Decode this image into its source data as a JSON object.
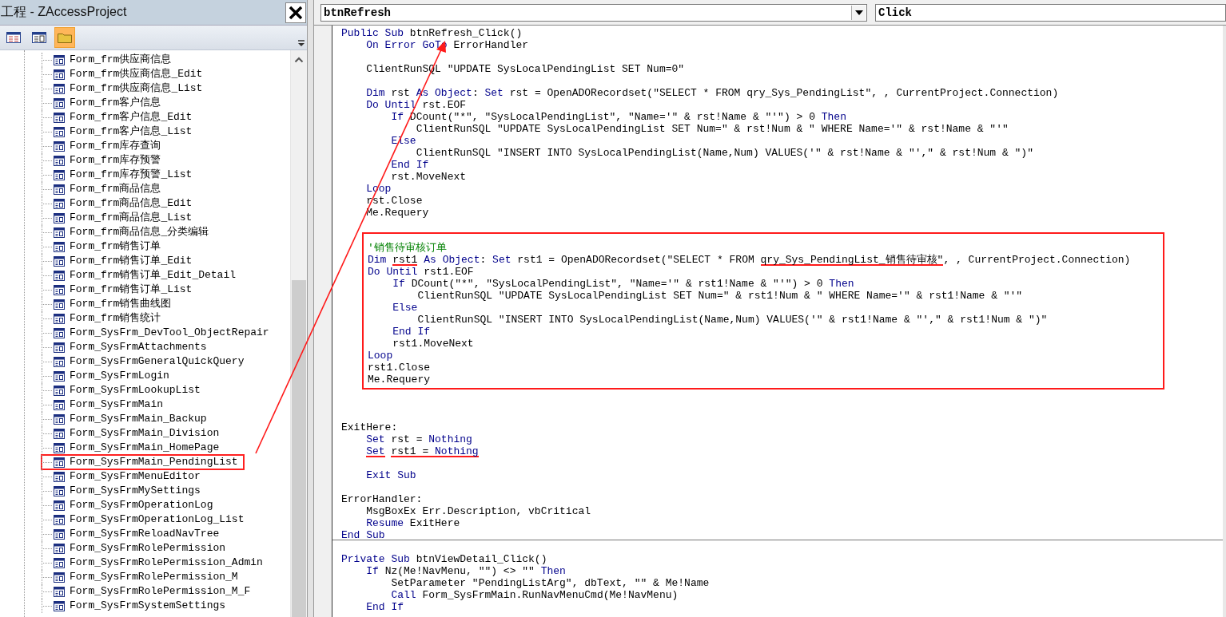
{
  "project_panel": {
    "title": "工程 - ZAccessProject",
    "toolbar": [
      {
        "kind": "view-code",
        "selected": false
      },
      {
        "kind": "view-object",
        "selected": false
      },
      {
        "kind": "toggle-folders",
        "selected": true
      }
    ],
    "tree_items": [
      {
        "label": "Form_frm供应商信息",
        "highlighted": false
      },
      {
        "label": "Form_frm供应商信息_Edit",
        "highlighted": false
      },
      {
        "label": "Form_frm供应商信息_List",
        "highlighted": false
      },
      {
        "label": "Form_frm客户信息",
        "highlighted": false
      },
      {
        "label": "Form_frm客户信息_Edit",
        "highlighted": false
      },
      {
        "label": "Form_frm客户信息_List",
        "highlighted": false
      },
      {
        "label": "Form_frm库存查询",
        "highlighted": false
      },
      {
        "label": "Form_frm库存预警",
        "highlighted": false
      },
      {
        "label": "Form_frm库存预警_List",
        "highlighted": false
      },
      {
        "label": "Form_frm商品信息",
        "highlighted": false
      },
      {
        "label": "Form_frm商品信息_Edit",
        "highlighted": false
      },
      {
        "label": "Form_frm商品信息_List",
        "highlighted": false
      },
      {
        "label": "Form_frm商品信息_分类编辑",
        "highlighted": false
      },
      {
        "label": "Form_frm销售订单",
        "highlighted": false
      },
      {
        "label": "Form_frm销售订单_Edit",
        "highlighted": false
      },
      {
        "label": "Form_frm销售订单_Edit_Detail",
        "highlighted": false
      },
      {
        "label": "Form_frm销售订单_List",
        "highlighted": false
      },
      {
        "label": "Form_frm销售曲线图",
        "highlighted": false
      },
      {
        "label": "Form_frm销售统计",
        "highlighted": false
      },
      {
        "label": "Form_SysFrm_DevTool_ObjectRepair",
        "highlighted": false
      },
      {
        "label": "Form_SysFrmAttachments",
        "highlighted": false
      },
      {
        "label": "Form_SysFrmGeneralQuickQuery",
        "highlighted": false
      },
      {
        "label": "Form_SysFrmLogin",
        "highlighted": false
      },
      {
        "label": "Form_SysFrmLookupList",
        "highlighted": false
      },
      {
        "label": "Form_SysFrmMain",
        "highlighted": false
      },
      {
        "label": "Form_SysFrmMain_Backup",
        "highlighted": false
      },
      {
        "label": "Form_SysFrmMain_Division",
        "highlighted": false
      },
      {
        "label": "Form_SysFrmMain_HomePage",
        "highlighted": false
      },
      {
        "label": "Form_SysFrmMain_PendingList",
        "highlighted": true
      },
      {
        "label": "Form_SysFrmMenuEditor",
        "highlighted": false
      },
      {
        "label": "Form_SysFrmMySettings",
        "highlighted": false
      },
      {
        "label": "Form_SysFrmOperationLog",
        "highlighted": false
      },
      {
        "label": "Form_SysFrmOperationLog_List",
        "highlighted": false
      },
      {
        "label": "Form_SysFrmReloadNavTree",
        "highlighted": false
      },
      {
        "label": "Form_SysFrmRolePermission",
        "highlighted": false
      },
      {
        "label": "Form_SysFrmRolePermission_Admin",
        "highlighted": false
      },
      {
        "label": "Form_SysFrmRolePermission_M",
        "highlighted": false
      },
      {
        "label": "Form_SysFrmRolePermission_M_F",
        "highlighted": false
      },
      {
        "label": "Form_SysFrmSystemSettings",
        "highlighted": false
      }
    ]
  },
  "editor": {
    "object_combo": "btnRefresh",
    "procedure_combo": "Click",
    "procedures": [
      {
        "blocks": [
          {
            "boxed": false,
            "lines": [
              {
                "kind": "code",
                "segments": [
                  {
                    "text": "Public Sub",
                    "kind": "keyword",
                    "underlined": false
                  },
                  {
                    "text": " btnRefresh_Click()",
                    "kind": "code",
                    "underlined": false
                  }
                ]
              },
              {
                "kind": "code",
                "segments": [
                  {
                    "text": "    On Error GoTo",
                    "kind": "keyword",
                    "underlined": false
                  },
                  {
                    "text": " ErrorHandler",
                    "kind": "code",
                    "underlined": false
                  }
                ]
              },
              {
                "kind": "blank"
              },
              {
                "kind": "code",
                "segments": [
                  {
                    "text": "    ClientRunSQL \"UPDATE SysLocalPendingList SET Num=0\"",
                    "kind": "code",
                    "underlined": false
                  }
                ]
              },
              {
                "kind": "blank"
              },
              {
                "kind": "code",
                "segments": [
                  {
                    "text": "    Dim",
                    "kind": "keyword",
                    "underlined": false
                  },
                  {
                    "text": " rst ",
                    "kind": "code",
                    "underlined": false
                  },
                  {
                    "text": "As Object",
                    "kind": "keyword",
                    "underlined": false
                  },
                  {
                    "text": ": ",
                    "kind": "code",
                    "underlined": false
                  },
                  {
                    "text": "Set",
                    "kind": "keyword",
                    "underlined": false
                  },
                  {
                    "text": " rst = OpenADORecordset(\"SELECT * FROM qry_Sys_PendingList\", , CurrentProject.Connection)",
                    "kind": "code",
                    "underlined": false
                  }
                ]
              },
              {
                "kind": "code",
                "segments": [
                  {
                    "text": "    Do Until",
                    "kind": "keyword",
                    "underlined": false
                  },
                  {
                    "text": " rst.EOF",
                    "kind": "code",
                    "underlined": false
                  }
                ]
              },
              {
                "kind": "code",
                "segments": [
                  {
                    "text": "        If",
                    "kind": "keyword",
                    "underlined": false
                  },
                  {
                    "text": " DCount(\"*\", \"SysLocalPendingList\", \"Name='\" & rst!Name & \"'\") > 0 ",
                    "kind": "code",
                    "underlined": false
                  },
                  {
                    "text": "Then",
                    "kind": "keyword",
                    "underlined": false
                  }
                ]
              },
              {
                "kind": "code",
                "segments": [
                  {
                    "text": "            ClientRunSQL \"UPDATE SysLocalPendingList SET Num=\" & rst!Num & \" WHERE Name='\" & rst!Name & \"'\"",
                    "kind": "code",
                    "underlined": false
                  }
                ]
              },
              {
                "kind": "code",
                "segments": [
                  {
                    "text": "        Else",
                    "kind": "keyword",
                    "underlined": false
                  }
                ]
              },
              {
                "kind": "code",
                "segments": [
                  {
                    "text": "            ClientRunSQL \"INSERT INTO SysLocalPendingList(Name,Num) VALUES('\" & rst!Name & \"',\" & rst!Num & \")\"",
                    "kind": "code",
                    "underlined": false
                  }
                ]
              },
              {
                "kind": "code",
                "segments": [
                  {
                    "text": "        End If",
                    "kind": "keyword",
                    "underlined": false
                  }
                ]
              },
              {
                "kind": "code",
                "segments": [
                  {
                    "text": "        rst.MoveNext",
                    "kind": "code",
                    "underlined": false
                  }
                ]
              },
              {
                "kind": "code",
                "segments": [
                  {
                    "text": "    Loop",
                    "kind": "keyword",
                    "underlined": false
                  }
                ]
              },
              {
                "kind": "code",
                "segments": [
                  {
                    "text": "    rst.Close",
                    "kind": "code",
                    "underlined": false
                  }
                ]
              },
              {
                "kind": "code",
                "segments": [
                  {
                    "text": "    Me.Requery",
                    "kind": "code",
                    "underlined": false
                  }
                ]
              },
              {
                "kind": "blank"
              }
            ]
          },
          {
            "boxed": true,
            "lines": [
              {
                "kind": "code",
                "segments": [
                  {
                    "text": "'销售待审核订单",
                    "kind": "comment",
                    "underlined": false
                  }
                ]
              },
              {
                "kind": "code",
                "segments": [
                  {
                    "text": "Dim ",
                    "kind": "keyword",
                    "underlined": false
                  },
                  {
                    "text": "rst1",
                    "kind": "code",
                    "underlined": true
                  },
                  {
                    "text": " As Object",
                    "kind": "keyword",
                    "underlined": false
                  },
                  {
                    "text": ": ",
                    "kind": "code",
                    "underlined": false
                  },
                  {
                    "text": "Set",
                    "kind": "keyword",
                    "underlined": false
                  },
                  {
                    "text": " rst1 = OpenADORecordset(\"SELECT * FROM ",
                    "kind": "code",
                    "underlined": false
                  },
                  {
                    "text": "qry_Sys_PendingList_销售待审核\"",
                    "kind": "code",
                    "underlined": true
                  },
                  {
                    "text": ", , CurrentProject.Connection)",
                    "kind": "code",
                    "underlined": false
                  }
                ]
              },
              {
                "kind": "code",
                "segments": [
                  {
                    "text": "Do Until",
                    "kind": "keyword",
                    "underlined": false
                  },
                  {
                    "text": " rst1.EOF",
                    "kind": "code",
                    "underlined": false
                  }
                ]
              },
              {
                "kind": "code",
                "segments": [
                  {
                    "text": "    If",
                    "kind": "keyword",
                    "underlined": false
                  },
                  {
                    "text": " DCount(\"*\", \"SysLocalPendingList\", \"Name='\" & rst1!Name & \"'\") > 0 ",
                    "kind": "code",
                    "underlined": false
                  },
                  {
                    "text": "Then",
                    "kind": "keyword",
                    "underlined": false
                  }
                ]
              },
              {
                "kind": "code",
                "segments": [
                  {
                    "text": "        ClientRunSQL \"UPDATE SysLocalPendingList SET Num=\" & rst1!Num & \" WHERE Name='\" & rst1!Name & \"'\"",
                    "kind": "code",
                    "underlined": false
                  }
                ]
              },
              {
                "kind": "code",
                "segments": [
                  {
                    "text": "    Else",
                    "kind": "keyword",
                    "underlined": false
                  }
                ]
              },
              {
                "kind": "code",
                "segments": [
                  {
                    "text": "        ClientRunSQL \"INSERT INTO SysLocalPendingList(Name,Num) VALUES('\" & rst1!Name & \"',\" & rst1!Num & \")\"",
                    "kind": "code",
                    "underlined": false
                  }
                ]
              },
              {
                "kind": "code",
                "segments": [
                  {
                    "text": "    End If",
                    "kind": "keyword",
                    "underlined": false
                  }
                ]
              },
              {
                "kind": "code",
                "segments": [
                  {
                    "text": "    rst1.MoveNext",
                    "kind": "code",
                    "underlined": false
                  }
                ]
              },
              {
                "kind": "code",
                "segments": [
                  {
                    "text": "Loop",
                    "kind": "keyword",
                    "underlined": false
                  }
                ]
              },
              {
                "kind": "code",
                "segments": [
                  {
                    "text": "rst1.Close",
                    "kind": "code",
                    "underlined": false
                  }
                ]
              },
              {
                "kind": "code",
                "segments": [
                  {
                    "text": "Me.Requery",
                    "kind": "code",
                    "underlined": false
                  }
                ]
              }
            ]
          },
          {
            "boxed": false,
            "lines": [
              {
                "kind": "code",
                "segments": [
                  {
                    "text": "ExitHere:",
                    "kind": "code",
                    "underlined": false
                  }
                ]
              },
              {
                "kind": "code",
                "segments": [
                  {
                    "text": "    Set",
                    "kind": "keyword",
                    "underlined": false
                  },
                  {
                    "text": " rst = ",
                    "kind": "code",
                    "underlined": false
                  },
                  {
                    "text": "Nothing",
                    "kind": "keyword",
                    "underlined": false
                  }
                ]
              },
              {
                "kind": "code",
                "segments": [
                  {
                    "text": "    Set",
                    "kind": "keyword",
                    "underlined": true
                  },
                  {
                    "text": " rst1 = ",
                    "kind": "code",
                    "underlined": true
                  },
                  {
                    "text": "Nothing",
                    "kind": "keyword",
                    "underlined": true
                  }
                ]
              },
              {
                "kind": "blank"
              },
              {
                "kind": "code",
                "segments": [
                  {
                    "text": "    Exit Sub",
                    "kind": "keyword",
                    "underlined": false
                  }
                ]
              },
              {
                "kind": "blank"
              },
              {
                "kind": "code",
                "segments": [
                  {
                    "text": "ErrorHandler:",
                    "kind": "code",
                    "underlined": false
                  }
                ]
              },
              {
                "kind": "code",
                "segments": [
                  {
                    "text": "    MsgBoxEx Err.Description, vbCritical",
                    "kind": "code",
                    "underlined": false
                  }
                ]
              },
              {
                "kind": "code",
                "segments": [
                  {
                    "text": "    Resume",
                    "kind": "keyword",
                    "underlined": false
                  },
                  {
                    "text": " ExitHere",
                    "kind": "code",
                    "underlined": false
                  }
                ]
              },
              {
                "kind": "code",
                "segments": [
                  {
                    "text": "End Sub",
                    "kind": "keyword",
                    "underlined": false
                  }
                ]
              }
            ]
          }
        ]
      },
      {
        "blocks": [
          {
            "boxed": false,
            "lines": [
              {
                "kind": "code",
                "segments": [
                  {
                    "text": "Private Sub",
                    "kind": "keyword",
                    "underlined": false
                  },
                  {
                    "text": " btnViewDetail_Click()",
                    "kind": "code",
                    "underlined": false
                  }
                ]
              },
              {
                "kind": "code",
                "segments": [
                  {
                    "text": "    If",
                    "kind": "keyword",
                    "underlined": false
                  },
                  {
                    "text": " Nz(Me!NavMenu, \"\") <> \"\" ",
                    "kind": "code",
                    "underlined": false
                  },
                  {
                    "text": "Then",
                    "kind": "keyword",
                    "underlined": false
                  }
                ]
              },
              {
                "kind": "code",
                "segments": [
                  {
                    "text": "        SetParameter \"PendingListArg\", dbText, \"\" & Me!Name",
                    "kind": "code",
                    "underlined": false
                  }
                ]
              },
              {
                "kind": "code",
                "segments": [
                  {
                    "text": "        Call",
                    "kind": "keyword",
                    "underlined": false
                  },
                  {
                    "text": " Form_SysFrmMain.RunNavMenuCmd(Me!NavMenu)",
                    "kind": "code",
                    "underlined": false
                  }
                ]
              },
              {
                "kind": "code",
                "segments": [
                  {
                    "text": "    End If",
                    "kind": "keyword",
                    "underlined": false
                  }
                ]
              }
            ]
          }
        ]
      }
    ]
  }
}
